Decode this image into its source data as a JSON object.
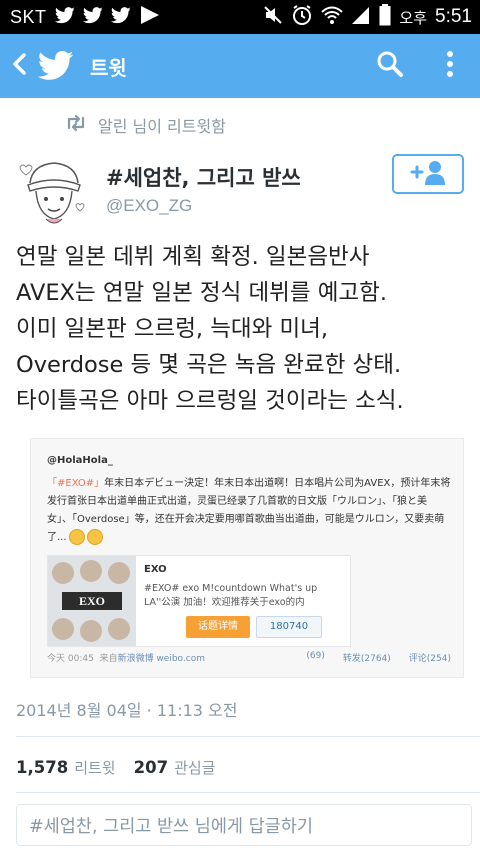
{
  "status_bar": {
    "carrier": "SKT",
    "left_icons": [
      "twitter-icon",
      "twitter-icon",
      "twitter-icon",
      "play-icon"
    ],
    "right_icons": [
      "mute-icon",
      "alarm-icon",
      "wifi-icon",
      "signal-icon",
      "battery-icon"
    ],
    "ampm": "오후",
    "time": "5:51"
  },
  "app_bar": {
    "title": "트윗",
    "color": "#55acee",
    "icons": [
      "back-arrow-icon",
      "twitter-bird-icon",
      "search-icon",
      "overflow-menu-icon"
    ]
  },
  "retweet_context": {
    "text": "알린 님이 리트윗함",
    "icon": "retweet-icon"
  },
  "author": {
    "name": "#세업찬, 그리고 받쓰",
    "handle": "@EXO_ZG",
    "follow_icon": "add-user-icon"
  },
  "tweet": {
    "text": "연말 일본 데뷔 계획 확정. 일본음반사\nAVEX는 연말 일본 정식 데뷔를 예고함.\n이미 일본판 으르렁, 늑대와 미녀,\nOverdose 등 몇 곡은 녹음 완료한 상태.\n타이틀곡은 아마 으르렁일 것이라는 소식."
  },
  "media": {
    "user": "@HolaHola_",
    "text_hash": "「#EXO#」",
    "text_body": "年末日本デビュー決定！年末日本出道啊！日本唱片公司为AVEX，预计年末将发行首张日本出道单曲正式出道，灵蛋已经录了几首歌的日文版「ウルロン」、「狼と美女」、「Overdose」等，还在开会决定要用哪首歌曲当出道曲，可能是ウルロン，又要卖萌了...",
    "card_title": "EXO",
    "card_desc": "#EXO# exo M!countdown What's up LA''公演 加油！欢迎推荐关于exo的内",
    "card_logo": "EXO",
    "topic_button": "话题详情",
    "like_count": "180740",
    "footer_time": "今天 00:45",
    "footer_from": "来自",
    "footer_source": "新浪微博 weibo.com",
    "stat_likes": "(69)",
    "stat_reposts": "转发(2764)",
    "stat_comments": "评论(254)"
  },
  "timestamp": "2014년 8월 04일 · 11:13 오전",
  "counts": {
    "retweets_num": "1,578",
    "retweets_label": "리트윗",
    "favorites_num": "207",
    "favorites_label": "관심글"
  },
  "reply": {
    "placeholder": "#세업찬, 그리고 받쓰 님에게 답글하기"
  }
}
